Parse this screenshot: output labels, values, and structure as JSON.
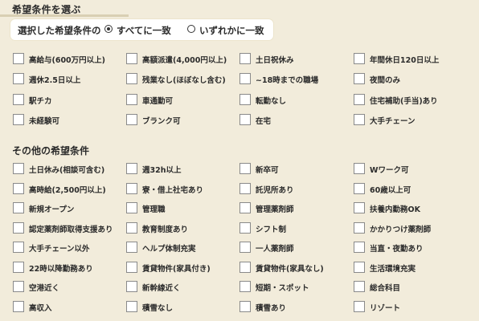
{
  "header": {
    "title": "希望条件を選ぶ"
  },
  "match_mode": {
    "label": "選択した希望条件の",
    "options": [
      {
        "label": "すべてに一致",
        "selected": true
      },
      {
        "label": "いずれかに一致",
        "selected": false
      }
    ]
  },
  "conditions": {
    "items": [
      "高給与(600万円以上)",
      "高額派遣(4,000円以上)",
      "土日祝休み",
      "年間休日120日以上",
      "週休2.5日以上",
      "残業なし(ほぼなし含む)",
      "~18時までの職場",
      "夜間のみ",
      "駅チカ",
      "車通勤可",
      "転勤なし",
      "住宅補助(手当)あり",
      "未経験可",
      "ブランク可",
      "在宅",
      "大手チェーン"
    ]
  },
  "other_conditions": {
    "title": "その他の希望条件",
    "items": [
      "土日休み(相談可含む)",
      "週32h以上",
      "新卒可",
      "Wワーク可",
      "高時給(2,500円以上)",
      "寮・借上社宅あり",
      "託児所あり",
      "60歳以上可",
      "新規オープン",
      "管理職",
      "管理薬剤師",
      "扶養内勤務OK",
      "認定薬剤師取得支援あり",
      "教育制度あり",
      "シフト制",
      "かかりつけ薬剤師",
      "大手チェーン以外",
      "ヘルプ体制充実",
      "一人薬剤師",
      "当直・夜勤あり",
      "22時以降勤務あり",
      "賃貸物件(家具付き)",
      "賃貸物件(家具なし)",
      "生活環境充実",
      "空港近く",
      "新幹線近く",
      "短期・スポット",
      "総合科目",
      "高収入",
      "積雪なし",
      "積雪あり",
      "リゾート"
    ]
  }
}
